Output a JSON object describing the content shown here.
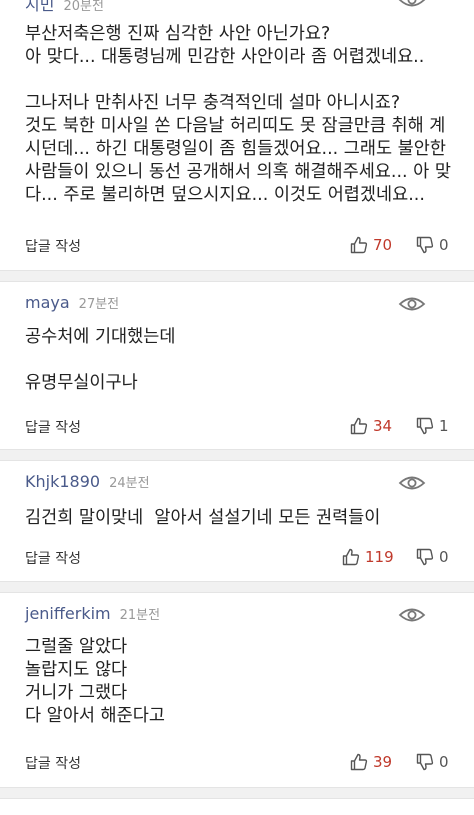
{
  "reply_label": "답글 작성",
  "colors": {
    "like": "#c0392b",
    "author": "#4a5a8a",
    "time": "#999999"
  },
  "comments": [
    {
      "author": "지민",
      "time": "20분전",
      "body": "부산저축은행 진짜 심각한 사안 아닌가요?\n아 맞다... 대통령님께 민감한 사안이라 좀 어렵겠네요..\n\n그나저나 만취사진 너무 충격적인데 설마 아니시죠?\n것도 북한 미사일 쏜 다음날 허리띠도 못 잠글만큼 취해 계\n시던데... 하긴 대통령일이 좀 힘들겠어요... 그래도 불안한\n사람들이 있으니 동선 공개해서 의혹 해결해주세요... 아 맞\n다... 주로 불리하면 덮으시지요... 이것도 어렵겠네요...",
      "likes": "70",
      "dislikes": "0"
    },
    {
      "author": "maya",
      "time": "27분전",
      "body": "공수처에 기대했는데\n\n유명무실이구나",
      "likes": "34",
      "dislikes": "1"
    },
    {
      "author": "Khjk1890",
      "time": "24분전",
      "body": "김건희 말이맞네  알아서 설설기네 모든 권력들이",
      "likes": "119",
      "dislikes": "0"
    },
    {
      "author": "jenifferkim",
      "time": "21분전",
      "body": "그럴줄 알았다\n놀랍지도 않다\n거니가 그랬다\n다 알아서 해준다고",
      "likes": "39",
      "dislikes": "0"
    }
  ]
}
